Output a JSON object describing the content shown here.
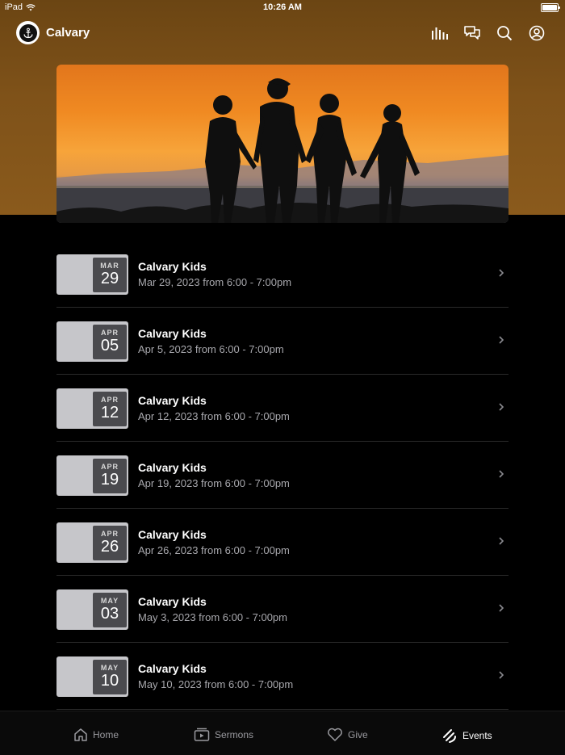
{
  "status_bar": {
    "device": "iPad",
    "time": "10:26 AM"
  },
  "header": {
    "title": "Calvary",
    "icons": [
      "bars-icon",
      "chat-icon",
      "search-icon",
      "account-icon"
    ]
  },
  "hero": {
    "alt": "silhouette family sunset photo"
  },
  "events": [
    {
      "month": "MAR",
      "day": "29",
      "title": "Calvary Kids",
      "subtitle": "Mar 29, 2023 from 6:00 - 7:00pm"
    },
    {
      "month": "APR",
      "day": "05",
      "title": "Calvary Kids",
      "subtitle": "Apr 5, 2023 from 6:00 - 7:00pm"
    },
    {
      "month": "APR",
      "day": "12",
      "title": "Calvary Kids",
      "subtitle": "Apr 12, 2023 from 6:00 - 7:00pm"
    },
    {
      "month": "APR",
      "day": "19",
      "title": "Calvary Kids",
      "subtitle": "Apr 19, 2023 from 6:00 - 7:00pm"
    },
    {
      "month": "APR",
      "day": "26",
      "title": "Calvary Kids",
      "subtitle": "Apr 26, 2023 from 6:00 - 7:00pm"
    },
    {
      "month": "MAY",
      "day": "03",
      "title": "Calvary Kids",
      "subtitle": "May 3, 2023 from 6:00 - 7:00pm"
    },
    {
      "month": "MAY",
      "day": "10",
      "title": "Calvary Kids",
      "subtitle": "May 10, 2023 from 6:00 - 7:00pm"
    }
  ],
  "tabs": [
    {
      "label": "Home",
      "icon": "home-icon",
      "active": false
    },
    {
      "label": "Sermons",
      "icon": "video-icon",
      "active": false
    },
    {
      "label": "Give",
      "icon": "heart-icon",
      "active": false
    },
    {
      "label": "Events",
      "icon": "events-icon",
      "active": true
    }
  ],
  "colors": {
    "header_bg": "#7f5219",
    "background": "#000000",
    "subtitle": "#a8a8ad",
    "thumb": "#c6c6ca"
  }
}
